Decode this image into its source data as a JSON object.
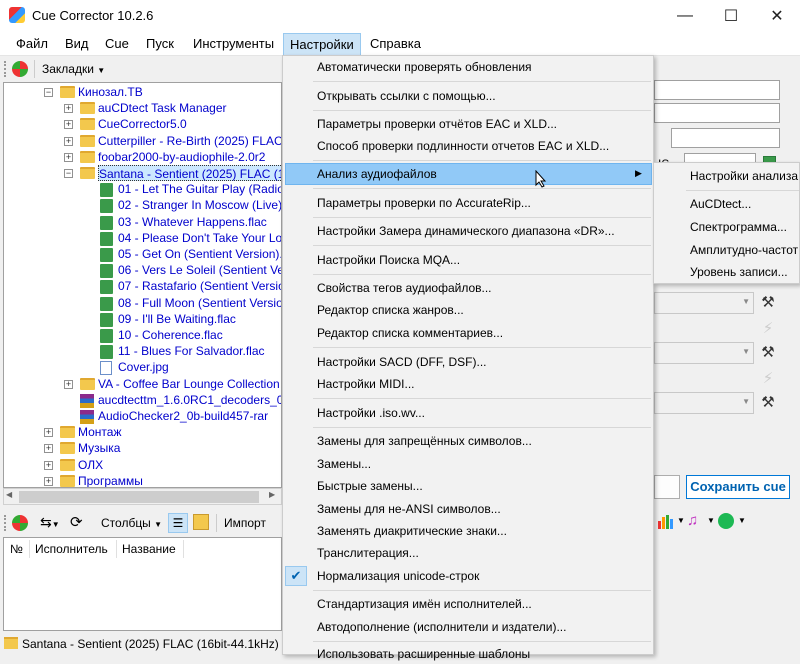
{
  "window": {
    "title": "Cue Corrector 10.2.6"
  },
  "menubar": [
    "Файл",
    "Вид",
    "Cue",
    "Пуск",
    "Инструменты",
    "Настройки",
    "Справка"
  ],
  "toolbar1": {
    "bookmarks_label": "Закладки"
  },
  "tree": {
    "items": [
      {
        "label": "Кинозал.ТВ",
        "type": "folder",
        "level": 2,
        "expander": "minus"
      },
      {
        "label": "auCDtect Task Manager",
        "type": "folder",
        "level": 3,
        "expander": "plus"
      },
      {
        "label": "CueCorrector5.0",
        "type": "folder",
        "level": 3,
        "expander": "plus"
      },
      {
        "label": "Cutterpiller - Re-Birth (2025) FLAC",
        "type": "folder",
        "level": 3,
        "expander": "plus"
      },
      {
        "label": "foobar2000-by-audiophile-2.0r2",
        "type": "folder",
        "level": 3,
        "expander": "plus"
      },
      {
        "label": "Santana - Sentient (2025) FLAC (16bit",
        "type": "folder",
        "level": 3,
        "expander": "minus",
        "selected": true
      },
      {
        "label": "01 - Let The Guitar Play (Radio V",
        "type": "audio",
        "level": 4
      },
      {
        "label": "02 - Stranger In Moscow (Live).fla",
        "type": "audio",
        "level": 4
      },
      {
        "label": "03 - Whatever Happens.flac",
        "type": "audio",
        "level": 4
      },
      {
        "label": "04 - Please Don't Take Your Love",
        "type": "audio",
        "level": 4
      },
      {
        "label": "05 - Get On (Sentient Version).fla",
        "type": "audio",
        "level": 4
      },
      {
        "label": "06 - Vers Le Soleil (Sentient Versi",
        "type": "audio",
        "level": 4
      },
      {
        "label": "07 - Rastafario (Sentient Version)",
        "type": "audio",
        "level": 4
      },
      {
        "label": "08 - Full Moon (Sentient Version).f",
        "type": "audio",
        "level": 4
      },
      {
        "label": "09 - I'll Be Waiting.flac",
        "type": "audio",
        "level": 4
      },
      {
        "label": "10 - Coherence.flac",
        "type": "audio",
        "level": 4
      },
      {
        "label": "11 - Blues For Salvador.flac",
        "type": "audio",
        "level": 4
      },
      {
        "label": "Cover.jpg",
        "type": "image",
        "level": 4
      },
      {
        "label": "VA - Coffee Bar Lounge Collection [F",
        "type": "folder",
        "level": 3,
        "expander": "plus"
      },
      {
        "label": "aucdtecttm_1.6.0RC1_decoders_010",
        "type": "rar",
        "level": 3
      },
      {
        "label": "AudioChecker2_0b-build457-rar",
        "type": "rar",
        "level": 3
      },
      {
        "label": "Монтаж",
        "type": "folder",
        "level": 2,
        "expander": "plus"
      },
      {
        "label": "Музыка",
        "type": "folder",
        "level": 2,
        "expander": "plus"
      },
      {
        "label": "ОЛХ",
        "type": "folder",
        "level": 2,
        "expander": "plus"
      },
      {
        "label": "Программы",
        "type": "folder",
        "level": 2,
        "expander": "plus"
      }
    ]
  },
  "toolbar2": {
    "columns_label": "Столбцы",
    "import_label": "Импорт"
  },
  "track_table": {
    "columns": [
      "№",
      "Исполнитель",
      "Название"
    ]
  },
  "status": {
    "text": "Santana - Sentient (2025) FLAC (16bit-44.1kHz)"
  },
  "right_panel": {
    "save_cue_label": "Сохранить cue",
    "partial_label": "IS"
  },
  "dropdown": {
    "items": [
      "Автоматически проверять обновления",
      "Открывать ссылки с помощью...",
      "Параметры проверки отчётов EAC и XLD...",
      "Способ проверки подлинности отчетов EAC и XLD...",
      "Анализ аудиофайлов",
      "Параметры проверки по AccurateRip...",
      "Настройки Замера динамического диапазона «DR»...",
      "Настройки Поиска MQA...",
      "Свойства тегов аудиофайлов...",
      "Редактор списка жанров...",
      "Редактор списка комментариев...",
      "Настройки SACD (DFF, DSF)...",
      "Настройки MIDI...",
      "Настройки .iso.wv...",
      "Замены для запрещённых символов...",
      "Замены...",
      "Быстрые замены...",
      "Замены для не-ANSI символов...",
      "Заменять диакритические знаки...",
      "Транслитерация...",
      "Нормализация unicode-строк",
      "Стандартизация имён исполнителей...",
      "Автодополнение (исполнители и издатели)...",
      "Использовать расширенные шаблоны"
    ]
  },
  "submenu": {
    "items": [
      "Настройки анализа",
      "AuCDtect...",
      "Спектрограмма...",
      "Амплитудно-частот",
      "Уровень записи..."
    ]
  }
}
